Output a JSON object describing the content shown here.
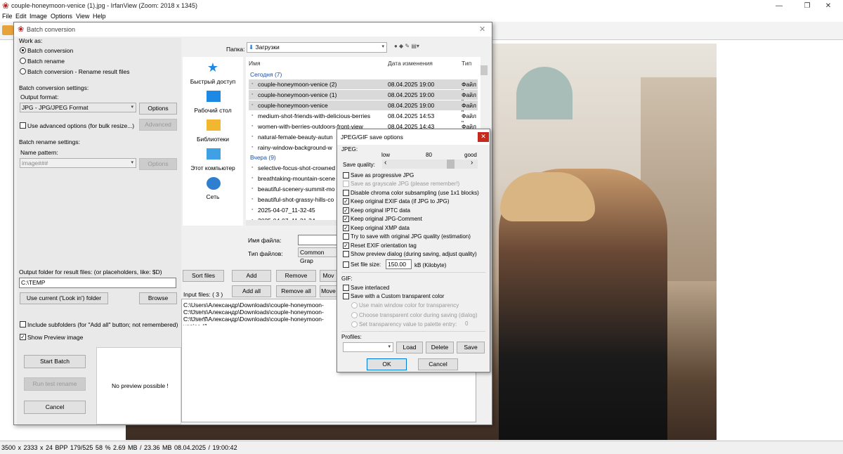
{
  "window": {
    "title": "couple-honeymoon-venice (1).jpg - IrfanView (Zoom: 2018 x 1345)",
    "min": "—",
    "max": "❐",
    "close": "✕"
  },
  "menu": [
    "File",
    "Edit",
    "Image",
    "Options",
    "View",
    "Help"
  ],
  "status": {
    "text": "3500 x 2333 x 24 BPP    179/525    58 %    2.69 MB / 23.36 MB    08.04.2025 / 19:00:42"
  },
  "batch": {
    "title": "Batch conversion",
    "close": "✕",
    "work_as_label": "Work as:",
    "modes": [
      "Batch conversion",
      "Batch rename",
      "Batch conversion - Rename result files"
    ],
    "conv_settings_label": "Batch conversion settings:",
    "output_format_label": "Output format:",
    "output_format_value": "JPG - JPG/JPEG Format",
    "options_label": "Options",
    "advanced_check_label": "Use advanced options (for bulk resize...)",
    "advanced_button": "Advanced",
    "rename_settings_label": "Batch rename settings:",
    "name_pattern_label": "Name pattern:",
    "name_pattern_value": "image###",
    "rename_options": "Options",
    "output_folder_label": "Output folder for result files: (or placeholders, like: $D)",
    "output_folder_value": "C:\\TEMP",
    "use_current_button": "Use current ('Look in') folder",
    "browse_button": "Browse",
    "include_subfolders": "Include subfolders (for \"Add all\" button; not remembered)",
    "show_preview": "Show Preview image",
    "start_batch": "Start Batch",
    "run_test": "Run test rename",
    "cancel": "Cancel",
    "no_preview": "No preview possible !",
    "folder_label": "Папка:",
    "folder_value": "Загрузки",
    "places": [
      "Быстрый доступ",
      "Рабочий стол",
      "Библиотеки",
      "Этот компьютер",
      "Сеть"
    ],
    "col_name": "Имя",
    "col_date": "Дата изменения",
    "col_type": "Тип",
    "group_today": "Сегодня (7)",
    "group_yesterday": "Вчера (9)",
    "files_today": [
      {
        "name": "couple-honeymoon-venice (2)",
        "date": "08.04.2025 19:00",
        "type": "Файл \""
      },
      {
        "name": "couple-honeymoon-venice (1)",
        "date": "08.04.2025 19:00",
        "type": "Файл \""
      },
      {
        "name": "couple-honeymoon-venice",
        "date": "08.04.2025 19:00",
        "type": "Файл \""
      },
      {
        "name": "medium-shot-friends-with-delicious-berries",
        "date": "08.04.2025 14:53",
        "type": "Файл \""
      },
      {
        "name": "women-with-berries-outdoors-front-view",
        "date": "08.04.2025 14:43",
        "type": "Файл \""
      },
      {
        "name": "natural-female-beauty-autun",
        "date": "",
        "type": ""
      },
      {
        "name": "rainy-window-background-w",
        "date": "",
        "type": ""
      }
    ],
    "files_yesterday": [
      "selective-focus-shot-crowned",
      "breathtaking-mountain-scene",
      "beautiful-scenery-summit-mo",
      "beautiful-shot-grassy-hills-co",
      "2025-04-07_11-32-45",
      "2025-04-07_11-31-34"
    ],
    "filename_label": "Имя файла:",
    "filetype_label": "Тип файлов:",
    "filetype_value": "Common Grap",
    "sort_files": "Sort files",
    "add": "Add",
    "remove": "Remove",
    "move": "Mov",
    "add_all": "Add all",
    "remove_all": "Remove all",
    "move2": "Move",
    "input_files_label": "Input files:  ( 3 )",
    "input_files": [
      "C:\\Users\\Александр\\Downloads\\couple-honeymoon-venice.jp",
      "C:\\Users\\Александр\\Downloads\\couple-honeymoon-venice (2",
      "C:\\Users\\Александр\\Downloads\\couple-honeymoon-venice (1"
    ]
  },
  "jpeg": {
    "title": "JPEG/GIF save options",
    "close": "✕",
    "jpeg_label": "JPEG:",
    "low": "low",
    "quality_value": "80",
    "good": "good",
    "save_quality_label": "Save quality:",
    "left_arrow": "‹",
    "right_arrow": "›",
    "options": [
      {
        "label": "Save as progressive JPG",
        "checked": false,
        "disabled": false
      },
      {
        "label": "Save as grayscale JPG (please remember!)",
        "checked": false,
        "disabled": true
      },
      {
        "label": "Disable chroma color subsampling (use 1x1 blocks)",
        "checked": false,
        "disabled": false
      },
      {
        "label": "Keep original EXIF data (if JPG to JPG)",
        "checked": true,
        "disabled": false
      },
      {
        "label": "Keep original IPTC data",
        "checked": true,
        "disabled": false
      },
      {
        "label": "Keep original JPG-Comment",
        "checked": true,
        "disabled": false
      },
      {
        "label": "Keep original XMP data",
        "checked": true,
        "disabled": false
      },
      {
        "label": "Try to save with original JPG quality (estimation)",
        "checked": false,
        "disabled": false
      },
      {
        "label": "Reset EXIF orientation tag",
        "checked": true,
        "disabled": false
      },
      {
        "label": "Show preview dialog (during saving, adjust quality)",
        "checked": false,
        "disabled": false
      }
    ],
    "set_file_size_label": "Set file size:",
    "file_size_value": "150.00",
    "file_size_unit": "kB (Kilobyte)",
    "gif_label": "GIF:",
    "save_interlaced": "Save interlaced",
    "custom_transparent": "Save with a Custom transparent color",
    "use_main_window": "Use main window color for transparency",
    "choose_transparent": "Choose transparent color during saving (dialog)",
    "set_transparency": "Set transparency value to palette entry:",
    "palette_value": "0",
    "profiles_label": "Profiles:",
    "load": "Load",
    "delete": "Delete",
    "save": "Save",
    "ok": "OK",
    "cancel": "Cancel"
  }
}
